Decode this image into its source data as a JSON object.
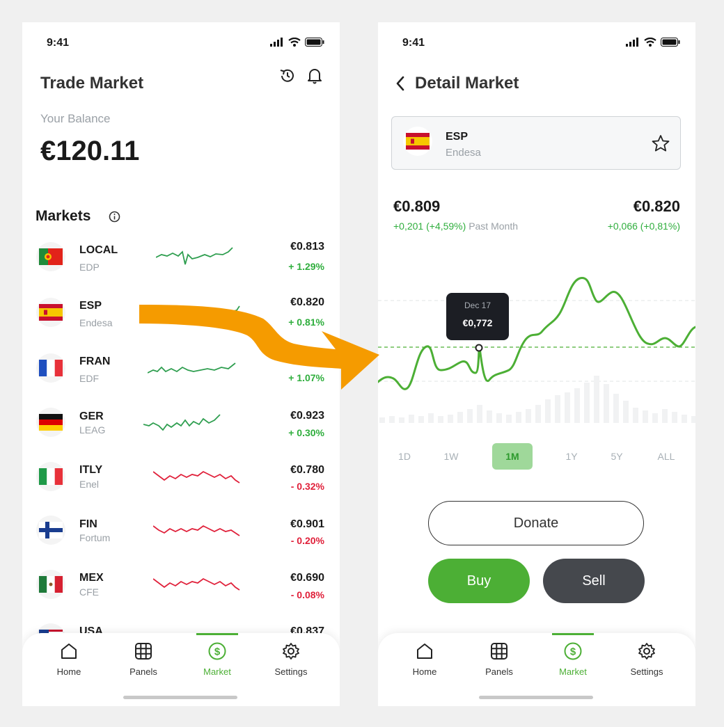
{
  "status": {
    "time": "9:41"
  },
  "left": {
    "title": "Trade Market",
    "balance_label": "Your Balance",
    "balance": "€120.11",
    "markets_title": "Markets",
    "rows": [
      {
        "symbol": "LOCAL",
        "name": "EDP",
        "price": "€0.813",
        "change": "+ 1.29%",
        "trend": "up"
      },
      {
        "symbol": "ESP",
        "name": "Endesa",
        "price": "€0.820",
        "change": "+ 0.81%",
        "trend": "up"
      },
      {
        "symbol": "FRAN",
        "name": "EDF",
        "price": "",
        "change": "+ 1.07%",
        "trend": "up"
      },
      {
        "symbol": "GER",
        "name": "LEAG",
        "price": "€0.923",
        "change": "+ 0.30%",
        "trend": "up"
      },
      {
        "symbol": "ITLY",
        "name": "Enel",
        "price": "€0.780",
        "change": "- 0.32%",
        "trend": "down"
      },
      {
        "symbol": "FIN",
        "name": "Fortum",
        "price": "€0.901",
        "change": "- 0.20%",
        "trend": "down"
      },
      {
        "symbol": "MEX",
        "name": "CFE",
        "price": "€0.690",
        "change": "- 0.08%",
        "trend": "down"
      },
      {
        "symbol": "USA",
        "name": "",
        "price": "€0.837",
        "change": "",
        "trend": "up"
      }
    ]
  },
  "right": {
    "title": "Detail Market",
    "asset": {
      "symbol": "ESP",
      "name": "Endesa"
    },
    "open_price": "€0.809",
    "open_change": "+0,201 (+4,59%)",
    "period_label": "Past Month",
    "current_price": "€0.820",
    "current_change": "+0,066 (+0,81%)",
    "tooltip": {
      "date": "Dec 17",
      "value": "€0,772"
    },
    "ranges": [
      "1D",
      "1W",
      "1M",
      "1Y",
      "5Y",
      "ALL"
    ],
    "active_range": "1M",
    "donate_label": "Donate",
    "buy_label": "Buy",
    "sell_label": "Sell"
  },
  "nav": {
    "items": [
      {
        "label": "Home",
        "icon": "home-icon"
      },
      {
        "label": "Panels",
        "icon": "grid-icon"
      },
      {
        "label": "Market",
        "icon": "dollar-icon"
      },
      {
        "label": "Settings",
        "icon": "gear-icon"
      }
    ],
    "active": "Market"
  },
  "colors": {
    "green": "#4caf35",
    "up": "#2e9e4f",
    "down": "#e0203a",
    "accent_arrow": "#f59b00",
    "dark": "#45484d"
  }
}
